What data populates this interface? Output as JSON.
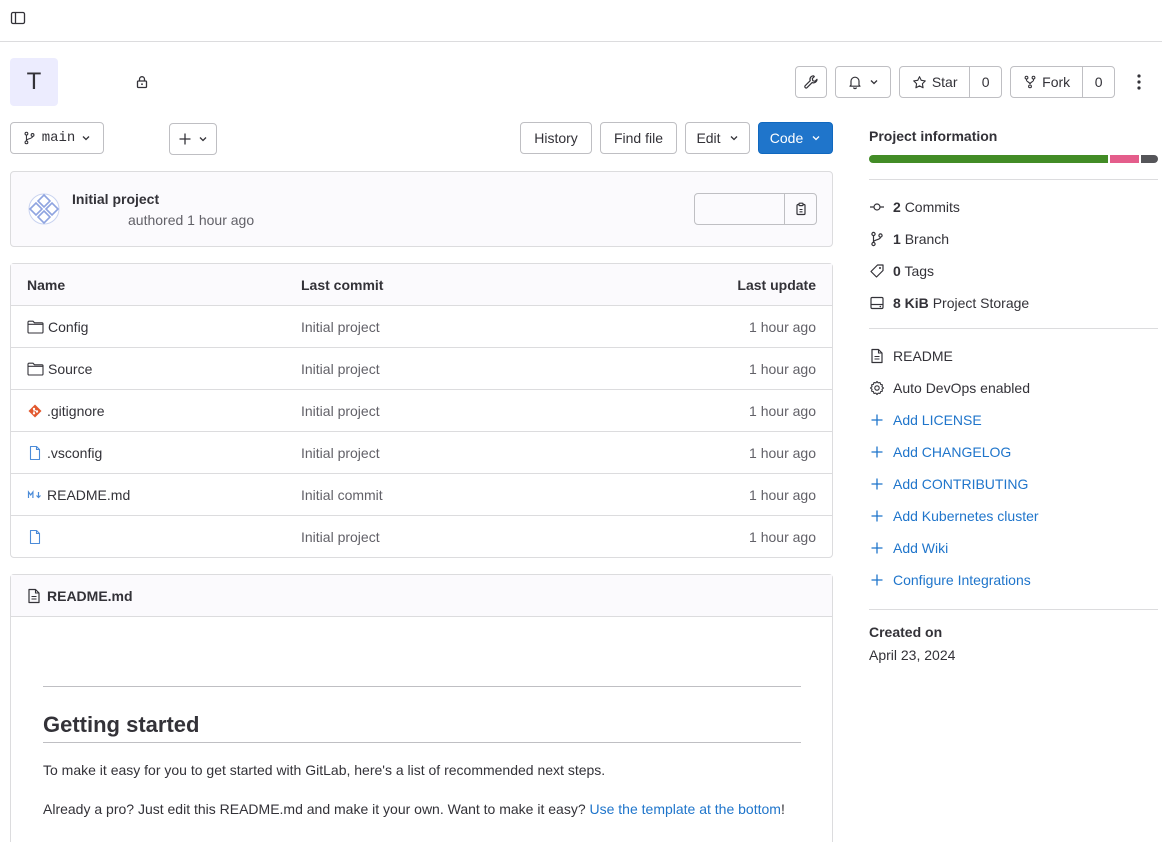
{
  "project": {
    "avatar_letter": "T"
  },
  "header": {
    "star_label": "Star",
    "star_count": "0",
    "fork_label": "Fork",
    "fork_count": "0"
  },
  "toolbar": {
    "branch": "main",
    "history": "History",
    "find_file": "Find file",
    "edit": "Edit",
    "code": "Code"
  },
  "last_commit": {
    "title": "Initial project",
    "meta": "authored 1 hour ago"
  },
  "file_table": {
    "headers": {
      "name": "Name",
      "last_commit": "Last commit",
      "last_update": "Last update"
    },
    "rows": [
      {
        "name": "Config",
        "icon": "folder-icon",
        "commit": "Initial project",
        "updated": "1 hour ago"
      },
      {
        "name": "Source",
        "icon": "folder-icon",
        "commit": "Initial project",
        "updated": "1 hour ago"
      },
      {
        "name": ".gitignore",
        "icon": "git-icon",
        "commit": "Initial project",
        "updated": "1 hour ago"
      },
      {
        "name": ".vsconfig",
        "icon": "file-icon",
        "commit": "Initial project",
        "updated": "1 hour ago"
      },
      {
        "name": "README.md",
        "icon": "markdown-icon",
        "commit": "Initial commit",
        "updated": "1 hour ago"
      },
      {
        "name": "",
        "icon": "file-icon",
        "commit": "Initial project",
        "updated": "1 hour ago"
      }
    ]
  },
  "readme": {
    "filename": "README.md",
    "heading": "Getting started",
    "p1": "To make it easy for you to get started with GitLab, here's a list of recommended next steps.",
    "p2_prefix": "Already a pro? Just edit this README.md and make it your own. Want to make it easy? ",
    "p2_link": "Use the template at the bottom",
    "p2_suffix": "!"
  },
  "sidebar": {
    "title": "Project information",
    "languages": [
      {
        "share": 84,
        "color": "#428c26"
      },
      {
        "share": 10,
        "color": "#e45d8b"
      },
      {
        "share": 6,
        "color": "#555559"
      }
    ],
    "stats": [
      {
        "count": "2",
        "label": "Commits",
        "icon": "commit-icon"
      },
      {
        "count": "1",
        "label": "Branch",
        "icon": "branch-icon"
      },
      {
        "count": "0",
        "label": "Tags",
        "icon": "tag-icon"
      },
      {
        "count": "8 KiB",
        "label": "Project Storage",
        "icon": "storage-icon"
      }
    ],
    "readme": "README",
    "auto_devops": "Auto DevOps enabled",
    "links": [
      "Add LICENSE",
      "Add CHANGELOG",
      "Add CONTRIBUTING",
      "Add Kubernetes cluster",
      "Add Wiki",
      "Configure Integrations"
    ],
    "created_label": "Created on",
    "created_date": "April 23, 2024"
  },
  "colors": {
    "primary": "#1f75cb",
    "border": "#dcdcde"
  }
}
